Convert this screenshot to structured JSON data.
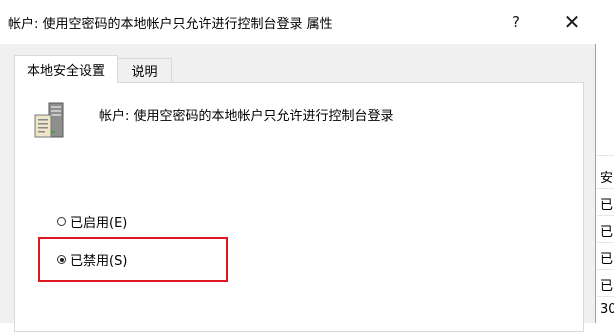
{
  "window": {
    "title": "帐户: 使用空密码的本地帐户只允许进行控制台登录 属性",
    "help_label": "?",
    "close_label": "✕"
  },
  "tabs": [
    {
      "label": "本地安全设置",
      "active": true
    },
    {
      "label": "说明",
      "active": false
    }
  ],
  "policy": {
    "icon": "server-computer-icon",
    "name": "帐户: 使用空密码的本地帐户只允许进行控制台登录"
  },
  "options": {
    "enabled_label": "已启用(E)",
    "disabled_label": "已禁用(S)",
    "selected": "disabled"
  },
  "background_window": {
    "cells": [
      "安",
      "已",
      "已",
      "已",
      "已",
      "30"
    ]
  },
  "colors": {
    "highlight": "#e0161e"
  }
}
